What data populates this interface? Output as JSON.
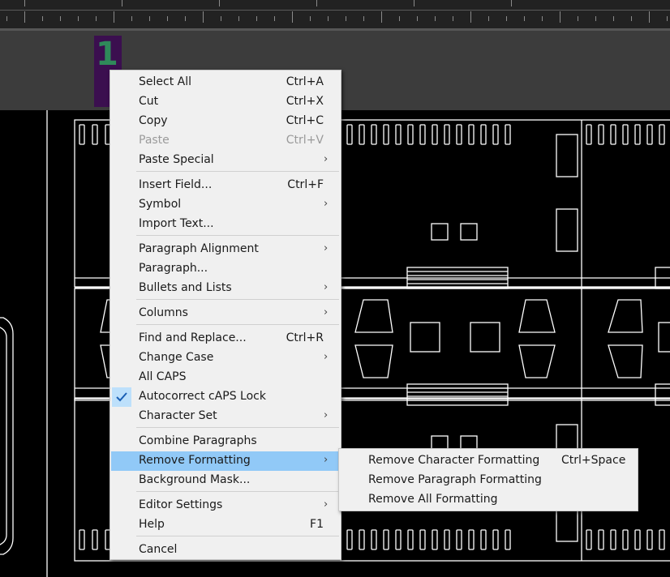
{
  "editor": {
    "mtext_content": "1"
  },
  "context_menu": {
    "items": [
      {
        "label": "Select All",
        "shortcut": "Ctrl+A"
      },
      {
        "label": "Cut",
        "shortcut": "Ctrl+X"
      },
      {
        "label": "Copy",
        "shortcut": "Ctrl+C"
      },
      {
        "label": "Paste",
        "shortcut": "Ctrl+V",
        "disabled": true
      },
      {
        "label": "Paste Special",
        "submenu": true
      },
      {
        "label": "Insert Field...",
        "shortcut": "Ctrl+F"
      },
      {
        "label": "Symbol",
        "submenu": true
      },
      {
        "label": "Import Text..."
      },
      {
        "label": "Paragraph Alignment",
        "submenu": true
      },
      {
        "label": "Paragraph..."
      },
      {
        "label": "Bullets and Lists",
        "submenu": true
      },
      {
        "label": "Columns",
        "submenu": true
      },
      {
        "label": "Find and Replace...",
        "shortcut": "Ctrl+R"
      },
      {
        "label": "Change Case",
        "submenu": true
      },
      {
        "label": "All CAPS"
      },
      {
        "label": "Autocorrect cAPS Lock",
        "checked": true
      },
      {
        "label": "Character Set",
        "submenu": true
      },
      {
        "label": "Combine Paragraphs"
      },
      {
        "label": "Remove Formatting",
        "submenu": true,
        "highlighted": true
      },
      {
        "label": "Background Mask..."
      },
      {
        "label": "Editor Settings",
        "submenu": true
      },
      {
        "label": "Help",
        "shortcut": "F1"
      },
      {
        "label": "Cancel"
      }
    ],
    "arrow_glyph": "›",
    "check_glyph": "✓"
  },
  "submenu_remove_formatting": {
    "items": [
      {
        "label": "Remove Character Formatting",
        "shortcut": "Ctrl+Space"
      },
      {
        "label": "Remove Paragraph Formatting"
      },
      {
        "label": "Remove All Formatting"
      }
    ]
  },
  "colors": {
    "menu_bg": "#f0f0f0",
    "highlight": "#91c9f7",
    "check_bg": "#bde0fb",
    "check_mark": "#1a5fb4",
    "drawing_lines": "#ffffff",
    "canvas_bg": "#000000"
  }
}
